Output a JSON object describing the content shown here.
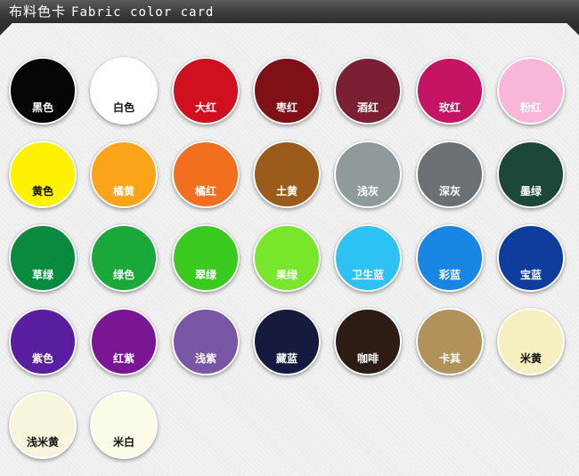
{
  "header": {
    "title_cn": "布料色卡",
    "title_en": "Fabric color card"
  },
  "swatches": [
    {
      "label": "黑色",
      "color": "#050505",
      "text": "#ffffff"
    },
    {
      "label": "白色",
      "color": "#ffffff",
      "text": "#111111"
    },
    {
      "label": "大红",
      "color": "#d0101e",
      "text": "#ffffff"
    },
    {
      "label": "枣红",
      "color": "#7f1018",
      "text": "#ffffff"
    },
    {
      "label": "酒红",
      "color": "#7a2032",
      "text": "#ffffff"
    },
    {
      "label": "玫红",
      "color": "#c51464",
      "text": "#ffffff"
    },
    {
      "label": "粉红",
      "color": "#f8b6d8",
      "text": "#ffffff"
    },
    {
      "label": "黄色",
      "color": "#fef200",
      "text": "#111111"
    },
    {
      "label": "橘黄",
      "color": "#fba319",
      "text": "#ffffff"
    },
    {
      "label": "橘红",
      "color": "#f36f20",
      "text": "#ffffff"
    },
    {
      "label": "土黄",
      "color": "#9a5b1c",
      "text": "#ffffff"
    },
    {
      "label": "浅灰",
      "color": "#8e9a9c",
      "text": "#ffffff"
    },
    {
      "label": "深灰",
      "color": "#6a7073",
      "text": "#ffffff"
    },
    {
      "label": "墨绿",
      "color": "#1c4739",
      "text": "#ffffff"
    },
    {
      "label": "草绿",
      "color": "#0a8a3f",
      "text": "#ffffff"
    },
    {
      "label": "绿色",
      "color": "#1aa83a",
      "text": "#ffffff"
    },
    {
      "label": "翠绿",
      "color": "#3ac91f",
      "text": "#ffffff"
    },
    {
      "label": "果绿",
      "color": "#78e62a",
      "text": "#ffffff"
    },
    {
      "label": "卫生蓝",
      "color": "#2ec2f2",
      "text": "#ffffff"
    },
    {
      "label": "彩蓝",
      "color": "#1a86e4",
      "text": "#ffffff"
    },
    {
      "label": "宝蓝",
      "color": "#0e3d9e",
      "text": "#ffffff"
    },
    {
      "label": "紫色",
      "color": "#5a1ea0",
      "text": "#ffffff"
    },
    {
      "label": "红紫",
      "color": "#7a1694",
      "text": "#ffffff"
    },
    {
      "label": "浅紫",
      "color": "#7a57a6",
      "text": "#ffffff"
    },
    {
      "label": "藏蓝",
      "color": "#151b3e",
      "text": "#ffffff"
    },
    {
      "label": "咖啡",
      "color": "#2c1c14",
      "text": "#ffffff"
    },
    {
      "label": "卡其",
      "color": "#b2915a",
      "text": "#ffffff"
    },
    {
      "label": "米黄",
      "color": "#f6f0c0",
      "text": "#111111"
    },
    {
      "label": "浅米黄",
      "color": "#f7f6dc",
      "text": "#111111"
    },
    {
      "label": "米白",
      "color": "#fbfbe8",
      "text": "#111111"
    }
  ]
}
